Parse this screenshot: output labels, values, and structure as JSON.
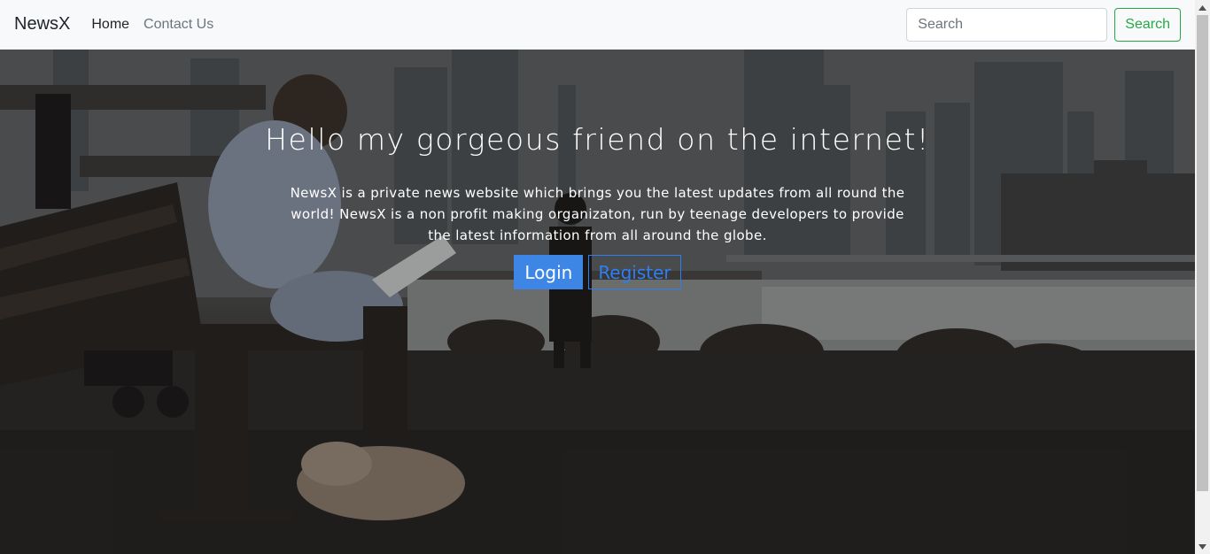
{
  "navbar": {
    "brand": "NewsX",
    "links": [
      {
        "label": "Home"
      },
      {
        "label": "Contact Us"
      }
    ],
    "search": {
      "placeholder": "Search",
      "button_label": "Search"
    }
  },
  "hero": {
    "title": "Hello my gorgeous friend on the internet!",
    "description": "NewsX is a private news website which brings you the latest updates from all round the world! NewsX is a non profit making organizaton, run by teenage developers to provide the latest information from all around the globe.",
    "login_label": "Login",
    "register_label": "Register"
  },
  "colors": {
    "login": "#3e86e5",
    "register": "#2d7ff5",
    "search_button": "#28a745",
    "navbar": "#f8f9fa"
  },
  "icons": {
    "scroll_up": "chevron-up-icon",
    "scroll_down": "chevron-down-icon"
  }
}
